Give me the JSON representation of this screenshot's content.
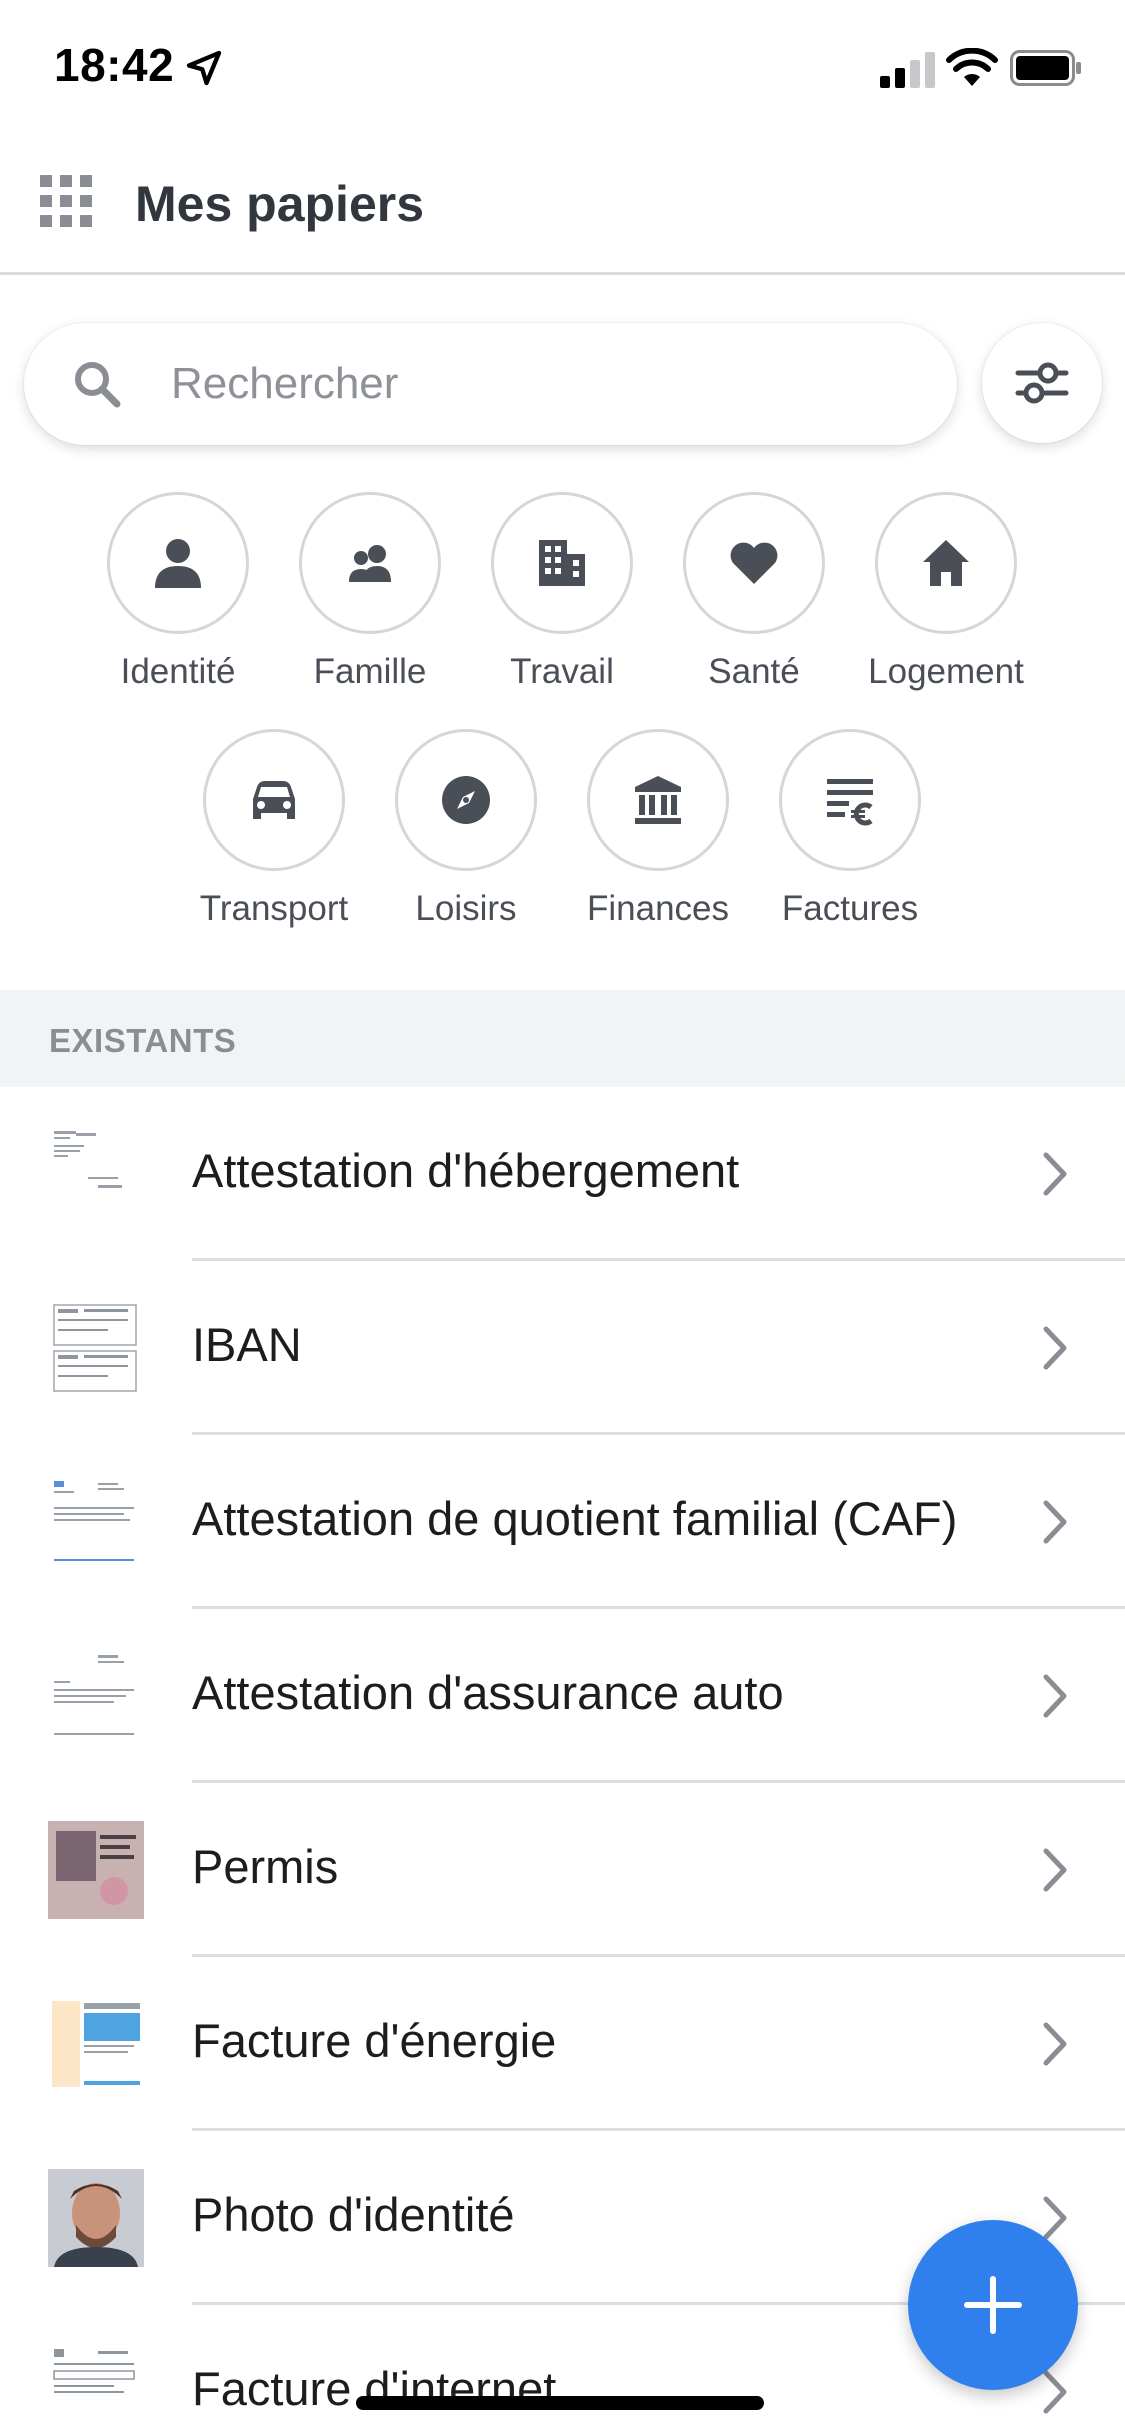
{
  "status_bar": {
    "time": "18:42"
  },
  "header": {
    "title": "Mes papiers"
  },
  "search": {
    "placeholder": "Rechercher"
  },
  "categories": [
    {
      "label": "Identité",
      "icon": "person-icon"
    },
    {
      "label": "Famille",
      "icon": "family-icon"
    },
    {
      "label": "Travail",
      "icon": "building-icon"
    },
    {
      "label": "Santé",
      "icon": "heart-icon"
    },
    {
      "label": "Logement",
      "icon": "house-icon"
    },
    {
      "label": "Transport",
      "icon": "car-icon"
    },
    {
      "label": "Loisirs",
      "icon": "compass-icon"
    },
    {
      "label": "Finances",
      "icon": "bank-icon"
    },
    {
      "label": "Factures",
      "icon": "bill-euro-icon"
    }
  ],
  "section": {
    "title": "EXISTANTS"
  },
  "documents": [
    {
      "title": "Attestation d'hébergement"
    },
    {
      "title": "IBAN"
    },
    {
      "title": "Attestation de quotient familial (CAF)"
    },
    {
      "title": "Attestation d'assurance auto"
    },
    {
      "title": "Permis"
    },
    {
      "title": "Facture d'énergie"
    },
    {
      "title": "Photo d'identité"
    },
    {
      "title": "Facture d'internet"
    }
  ],
  "colors": {
    "accent": "#2f80ed",
    "icon_gray": "#4a4e57",
    "section_bg": "#f2f3f4"
  }
}
